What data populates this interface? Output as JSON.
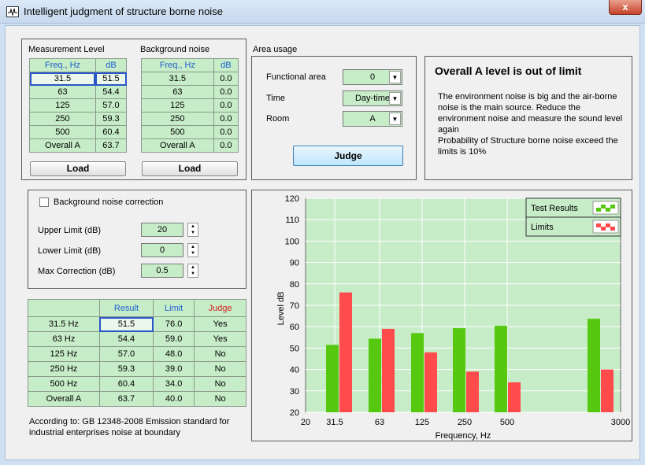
{
  "window": {
    "title": "Intelligent judgment of structure borne noise",
    "close_label": "x"
  },
  "measurement": {
    "title": "Measurement Level",
    "headers": [
      "Freq., Hz",
      "dB"
    ],
    "rows": [
      [
        "31.5",
        "51.5"
      ],
      [
        "63",
        "54.4"
      ],
      [
        "125",
        "57.0"
      ],
      [
        "250",
        "59.3"
      ],
      [
        "500",
        "60.4"
      ],
      [
        "Overall A",
        "63.7"
      ]
    ],
    "load_label": "Load"
  },
  "background": {
    "title": "Background noise",
    "headers": [
      "Freq., Hz",
      "dB"
    ],
    "rows": [
      [
        "31.5",
        "0.0"
      ],
      [
        "63",
        "0.0"
      ],
      [
        "125",
        "0.0"
      ],
      [
        "250",
        "0.0"
      ],
      [
        "500",
        "0.0"
      ],
      [
        "Overall A",
        "0.0"
      ]
    ],
    "load_label": "Load"
  },
  "area": {
    "title": "Area usage",
    "functional_label": "Functional area",
    "functional_value": "0",
    "time_label": "Time",
    "time_value": "Day-time",
    "room_label": "Room",
    "room_value": "A",
    "judge_label": "Judge"
  },
  "message": {
    "headline": "Overall A level is out of  limit",
    "body": "The environment noise is big and the air-borne noise is the main source. Reduce the environment noise and measure the sound level again",
    "probability": "Probability of Structure borne noise exceed the limits is  10%"
  },
  "correction": {
    "checkbox_label": "Background noise correction",
    "upper_label": "Upper Limit (dB)",
    "upper_value": "20",
    "lower_label": "Lower Limit (dB)",
    "lower_value": "0",
    "max_label": "Max Correction (dB)",
    "max_value": "0.5"
  },
  "results": {
    "headers": [
      "",
      "Result",
      "Limit",
      "Judge"
    ],
    "rows": [
      [
        "31.5 Hz",
        "51.5",
        "76.0",
        "Yes"
      ],
      [
        "63 Hz",
        "54.4",
        "59.0",
        "Yes"
      ],
      [
        "125 Hz",
        "57.0",
        "48.0",
        "No"
      ],
      [
        "250 Hz",
        "59.3",
        "39.0",
        "No"
      ],
      [
        "500 Hz",
        "60.4",
        "34.0",
        "No"
      ],
      [
        "Overall A",
        "63.7",
        "40.0",
        "No"
      ]
    ],
    "note": "According to: GB 12348-2008 Emission standard for industrial enterprises noise at boundary"
  },
  "colors": {
    "test": "#55c80f",
    "limit": "#ff4b4b",
    "plot_bg": "#c7ecc8"
  },
  "chart_data": {
    "type": "bar",
    "categories": [
      "31.5",
      "63",
      "125",
      "250",
      "500",
      "3000"
    ],
    "xtick_labels": [
      "20",
      "31.5",
      "63",
      "125",
      "250",
      "500",
      "3000"
    ],
    "series": [
      {
        "name": "Test Results",
        "values": [
          51.5,
          54.4,
          57.0,
          59.3,
          60.4,
          63.7
        ]
      },
      {
        "name": "Limits",
        "values": [
          76.0,
          59.0,
          48.0,
          39.0,
          34.0,
          40.0
        ]
      }
    ],
    "xlabel": "Frequency, Hz",
    "ylabel": "Level dB",
    "ylim": [
      20,
      120
    ],
    "yticks": [
      20,
      30,
      40,
      50,
      60,
      70,
      80,
      90,
      100,
      110,
      120
    ],
    "legend": "top-right",
    "grid": true
  }
}
